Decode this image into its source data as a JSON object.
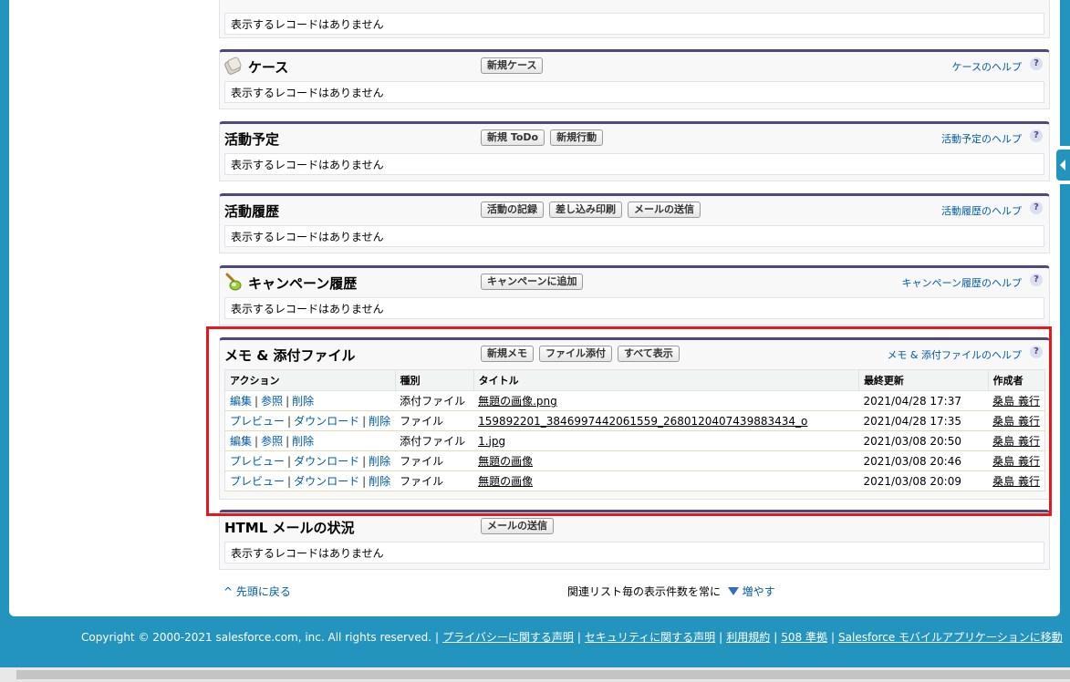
{
  "top_partial": {
    "empty_text": "表示するレコードはありません"
  },
  "sections": {
    "cases": {
      "title": "ケース",
      "buttons": [
        "新規ケース"
      ],
      "help": "ケースのヘルプ",
      "empty_text": "表示するレコードはありません"
    },
    "open_activities": {
      "title": "活動予定",
      "buttons": [
        "新規 ToDo",
        "新規行動"
      ],
      "help": "活動予定のヘルプ",
      "empty_text": "表示するレコードはありません"
    },
    "activity_history": {
      "title": "活動履歴",
      "buttons": [
        "活動の記録",
        "差し込み印刷",
        "メールの送信"
      ],
      "help": "活動履歴のヘルプ",
      "empty_text": "表示するレコードはありません"
    },
    "campaign_history": {
      "title": "キャンペーン履歴",
      "buttons": [
        "キャンペーンに追加"
      ],
      "help": "キャンペーン履歴のヘルプ",
      "empty_text": "表示するレコードはありません"
    },
    "notes_attachments": {
      "title": "メモ & 添付ファイル",
      "buttons": [
        "新規メモ",
        "ファイル添付",
        "すべて表示"
      ],
      "help": "メモ & 添付ファイルのヘルプ",
      "columns": [
        "アクション",
        "種別",
        "タイトル",
        "最終更新",
        "作成者"
      ],
      "rows": [
        {
          "actions": [
            "編集",
            "参照",
            "削除"
          ],
          "type": "添付ファイル",
          "title": "無題の画像.png",
          "modified": "2021/04/28 17:37",
          "owner": "桑島 義行"
        },
        {
          "actions": [
            "プレビュー",
            "ダウンロード",
            "削除"
          ],
          "type": "ファイル",
          "title": "159892201_3846997442061559_2680120407439883434_o",
          "modified": "2021/04/28 17:35",
          "owner": "桑島 義行"
        },
        {
          "actions": [
            "編集",
            "参照",
            "削除"
          ],
          "type": "添付ファイル",
          "title": "1.jpg",
          "modified": "2021/03/08 20:50",
          "owner": "桑島 義行"
        },
        {
          "actions": [
            "プレビュー",
            "ダウンロード",
            "削除"
          ],
          "type": "ファイル",
          "title": "無題の画像",
          "modified": "2021/03/08 20:46",
          "owner": "桑島 義行"
        },
        {
          "actions": [
            "プレビュー",
            "ダウンロード",
            "削除"
          ],
          "type": "ファイル",
          "title": "無題の画像",
          "modified": "2021/03/08 20:09",
          "owner": "桑島 義行"
        }
      ]
    },
    "html_email": {
      "title": "HTML メールの状況",
      "buttons": [
        "メールの送信"
      ],
      "empty_text": "表示するレコードはありません"
    }
  },
  "bottom": {
    "back_to_top": "^ 先頭に戻る",
    "more_rows_text": "関連リスト毎の表示件数を常に",
    "more_rows_link": "増やす"
  },
  "footer": {
    "copyright": "Copyright © 2000-2021 salesforce.com, inc. All rights reserved.",
    "links": [
      "プライバシーに関する声明",
      "セキュリティに関する声明",
      "利用規約",
      "508 準拠",
      "Salesforce モバイルアプリケーションに移動"
    ]
  },
  "colors": {
    "accent": "#51467e",
    "link": "#015ba7",
    "highlight": "#e5181f",
    "background": "#2394bd"
  }
}
